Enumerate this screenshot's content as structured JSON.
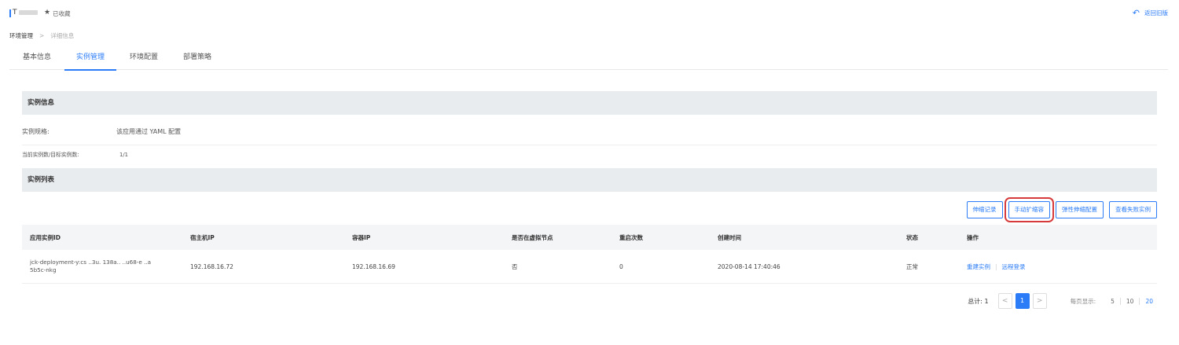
{
  "header": {
    "app_name": "T",
    "favorite_label": "已收藏",
    "back_label": "返回旧版"
  },
  "breadcrumb": {
    "root": "环境管理",
    "separator": ">",
    "current": "详细信息"
  },
  "tabs": [
    {
      "label": "基本信息",
      "active": false
    },
    {
      "label": "实例管理",
      "active": true
    },
    {
      "label": "环境配置",
      "active": false
    },
    {
      "label": "部署策略",
      "active": false
    }
  ],
  "instance_info": {
    "title": "实例信息",
    "spec_key": "实例规格:",
    "spec_value": "该应用通过 YAML 配置",
    "count_key": "当前实例数/目标实例数:",
    "count_value": "1/1"
  },
  "instance_list": {
    "title": "实例列表",
    "buttons": {
      "scale_log": "伸缩记录",
      "manual_scale": "手动扩缩容",
      "auto_scale": "弹性伸缩配置",
      "failed_instances": "查看失败实例"
    },
    "columns": [
      "应用实例ID",
      "宿主机IP",
      "容器IP",
      "是否在虚拟节点",
      "重启次数",
      "创建时间",
      "状态",
      "操作"
    ],
    "rows": [
      {
        "id_line1": "jck-deployment-y:cs ..3u. 138a.. ..u68-e ..a",
        "id_line2": "5b5c-nkg",
        "host_ip": "192.168.16.72",
        "container_ip": "192.168.16.69",
        "virtual_node": "否",
        "restarts": "0",
        "created": "2020-08-14 17:40:46",
        "status": "正常",
        "op_rebuild": "重建实例",
        "op_sep": "|",
        "op_remote": "远程登录"
      }
    ]
  },
  "pagination": {
    "total_label": "总计: 1",
    "prev": "<",
    "current_page": "1",
    "next": ">",
    "per_page_label": "每页显示:",
    "per_page_options": [
      "5",
      "10",
      "20"
    ],
    "per_page_selected": "20"
  },
  "colors": {
    "accent": "#2b7cf6",
    "highlight_border": "#d63a3a"
  }
}
